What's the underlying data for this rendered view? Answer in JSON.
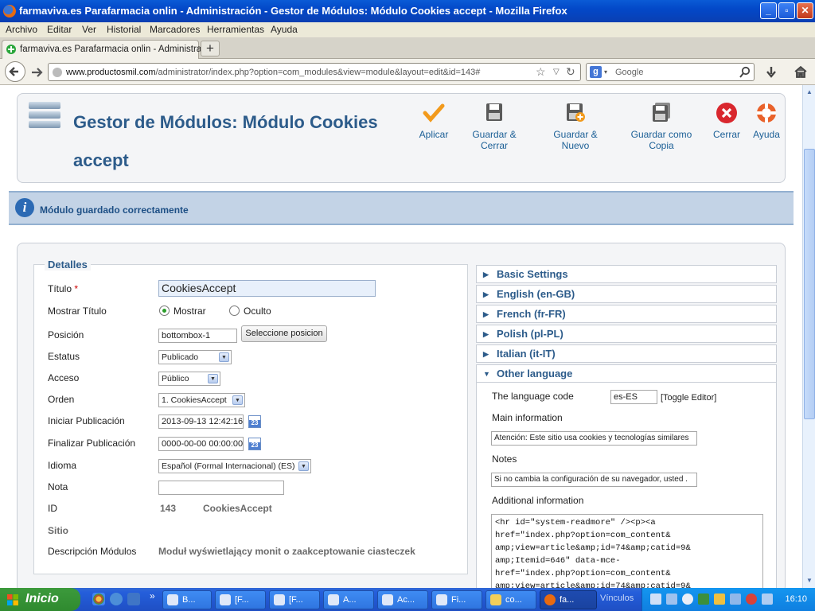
{
  "window": {
    "title": "farmaviva.es Parafarmacia onlin - Administración - Gestor de Módulos: Módulo Cookies accept - Mozilla Firefox",
    "minimize": "_",
    "maximize": "▫",
    "close": "✕"
  },
  "menubar": [
    "Archivo",
    "Editar",
    "Ver",
    "Historial",
    "Marcadores",
    "Herramientas",
    "Ayuda"
  ],
  "tab": {
    "label": "farmaviva.es Parafarmacia onlin - Administra...",
    "new_tab": "+"
  },
  "navbar": {
    "url_host": "www.productosmil.com",
    "url_path": "/administrator/index.php?option=com_modules&view=module&layout=edit&id=143#",
    "search_placeholder": "Google",
    "search_engine_letter": "g"
  },
  "toolbar": {
    "title_line1": "Gestor de Módulos: Módulo Cookies",
    "title_line2": "accept",
    "buttons": [
      {
        "label": "Aplicar",
        "icon": "check-icon"
      },
      {
        "label": "Guardar & Cerrar",
        "icon": "save-icon"
      },
      {
        "label": "Guardar & Nuevo",
        "icon": "save-new-icon"
      },
      {
        "label": "Guardar como Copia",
        "icon": "save-copy-icon"
      },
      {
        "label": "Cerrar",
        "icon": "close-icon"
      },
      {
        "label": "Ayuda",
        "icon": "lifebuoy-icon"
      }
    ]
  },
  "message": {
    "text": "Módulo guardado correctamente",
    "icon_letter": "i"
  },
  "details": {
    "legend": "Detalles",
    "titulo_label": "Título",
    "required_mark": "*",
    "titulo_value": "CookiesAccept",
    "mostrar_titulo_label": "Mostrar Título",
    "mostrar_option": "Mostrar",
    "oculto_option": "Oculto",
    "posicion_label": "Posición",
    "posicion_value": "bottombox-1",
    "posicion_button": "Seleccione posicion",
    "estatus_label": "Estatus",
    "estatus_value": "Publicado",
    "acceso_label": "Acceso",
    "acceso_value": "Público",
    "orden_label": "Orden",
    "orden_value": "1. CookiesAccept",
    "iniciar_label": "Iniciar Publicación",
    "iniciar_value": "2013-09-13 12:42:16",
    "finalizar_label": "Finalizar Publicación",
    "finalizar_value": "0000-00-00 00:00:00",
    "idioma_label": "Idioma",
    "idioma_value": "Español (Formal Internacional) (ES)",
    "nota_label": "Nota",
    "nota_value": "",
    "id_label": "ID",
    "id_value": "143",
    "id_name": "CookiesAccept",
    "sitio_label": "Sitio",
    "descripcion_label": "Descripción Módulos",
    "descripcion_value": "Moduł wyświetlający monit o zaakceptowanie ciasteczek",
    "calendar_glyph": "23"
  },
  "accordion": [
    {
      "label": "Basic Settings",
      "expanded": false
    },
    {
      "label": "English (en-GB)",
      "expanded": false
    },
    {
      "label": "French (fr-FR)",
      "expanded": false
    },
    {
      "label": "Polish (pl-PL)",
      "expanded": false
    },
    {
      "label": "Italian (it-IT)",
      "expanded": false
    },
    {
      "label": "Other language",
      "expanded": true
    }
  ],
  "other_language": {
    "language_code_label": "The language code",
    "language_code_value": "es-ES",
    "toggle_editor": "[Toggle Editor]",
    "main_info_label": "Main information",
    "main_info_value": "Atención: Este sitio usa cookies y tecnologías similares",
    "notes_label": "Notes",
    "notes_value": "Si no cambia la configuración de su navegador, usted .",
    "additional_label": "Additional information",
    "additional_value": "<hr id=\"system-readmore\" /><p><a\nhref=\"index.php?option=com_content&\namp;view=article&amp;id=74&amp;catid=9&\namp;Itemid=646\" data-mce-\nhref=\"index.php?option=com_content&\namp;view=article&amp;id=74&amp;catid=9&"
  },
  "taskbar": {
    "start_label": "Inicio",
    "more_quicklaunch": "»",
    "buttons": [
      "B...",
      "[F...",
      "[F...",
      "A...",
      "Ac...",
      "Fi...",
      "co...",
      "fa..."
    ],
    "vinculos": "Vínculos",
    "clock": "16:10"
  },
  "colors": {
    "accent": "#2c5b8a",
    "taskbar": "#245edb",
    "titlebar": "#0348c8"
  }
}
